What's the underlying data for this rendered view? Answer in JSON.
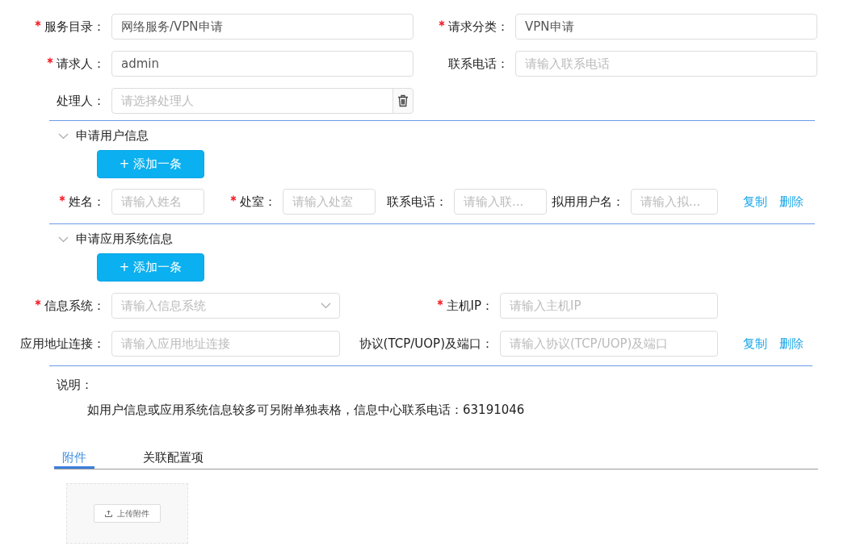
{
  "request_form": {
    "fields": [
      {
        "label": "服务目录：",
        "required": true,
        "kind": "text",
        "value": "网络服务/VPN申请"
      },
      {
        "label": "请求分类：",
        "required": true,
        "kind": "text",
        "value": "VPN申请"
      },
      {
        "label": "请求人：",
        "required": true,
        "kind": "text",
        "value": "admin"
      },
      {
        "label": "联系电话：",
        "required": false,
        "kind": "text",
        "placeholder": "请输入联系电话"
      },
      {
        "label": "处理人：",
        "required": false,
        "kind": "picker",
        "placeholder": "请选择处理人"
      }
    ]
  },
  "sections": [
    {
      "kind": "inline",
      "title": "申请用户信息",
      "expanded": true,
      "add_button": "+ 添加一条",
      "fields": [
        {
          "label": "姓名：",
          "required": true,
          "kind": "text",
          "placeholder": "请输入姓名"
        },
        {
          "label": "处室：",
          "required": true,
          "kind": "text",
          "placeholder": "请输入处室"
        },
        {
          "label": "联系电话：",
          "required": false,
          "kind": "text",
          "placeholder": "请输入联..."
        },
        {
          "label": "拟用用户名：",
          "required": false,
          "kind": "text",
          "placeholder": "请输入拟..."
        }
      ],
      "actions": [
        "复制",
        "删除"
      ]
    },
    {
      "kind": "grid",
      "title": "申请应用系统信息",
      "expanded": true,
      "add_button": "+ 添加一条",
      "fields": [
        {
          "label": "信息系统：",
          "required": true,
          "kind": "select",
          "placeholder": "请输入信息系统"
        },
        {
          "label": "主机IP：",
          "required": true,
          "kind": "text",
          "placeholder": "请输入主机IP"
        },
        {
          "label": "应用地址连接：",
          "required": false,
          "kind": "text",
          "placeholder": "请输入应用地址连接"
        },
        {
          "label": "协议(TCP/UOP)及端口：",
          "required": false,
          "kind": "text",
          "placeholder": "请输入协议(TCP/UOP)及端口"
        }
      ],
      "actions": [
        "复制",
        "删除"
      ]
    }
  ],
  "note": {
    "label": "说明：",
    "text": "如用户信息或应用系统信息较多可另附单独表格，信息中心联系电话：63191046"
  },
  "tabs": [
    {
      "label": "附件",
      "selected": true
    },
    {
      "label": "关联配置项",
      "selected": false
    }
  ],
  "upload": {
    "button": "上传附件"
  }
}
